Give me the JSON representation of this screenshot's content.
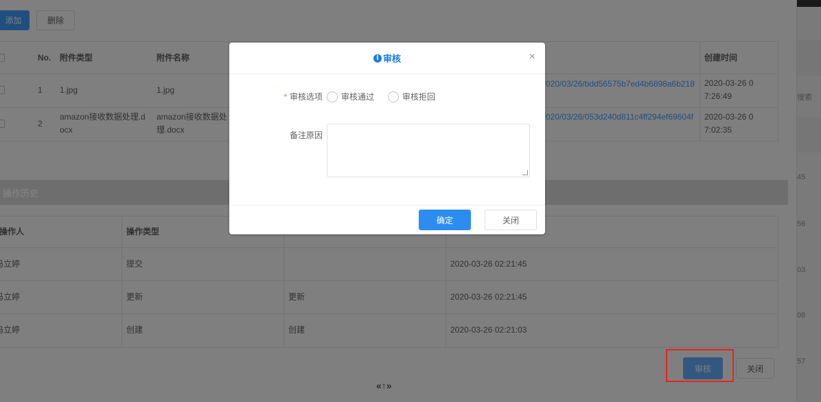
{
  "toolbar": {
    "add_label": "添加",
    "delete_label": "删除"
  },
  "attachments": {
    "headers": {
      "no": "No.",
      "type": "附件类型",
      "name": "附件名称",
      "created": "创建时间"
    },
    "rows": [
      {
        "no": "1",
        "type": "1.jpg",
        "name": "1.jpg",
        "path": "020/03/26/bdd56575b7ed4b6898a6b218",
        "created": "2020-03-26 07:26:49"
      },
      {
        "no": "2",
        "type": "amazon接收数据处理.docx",
        "name": "amazon接收数据处理.docx",
        "path": "020/03/26/053d240d811c4ff294ef69604f",
        "created": "2020-03-26 07:02:35"
      }
    ]
  },
  "history": {
    "section_title": "操作历史",
    "headers": {
      "operator": "操作人",
      "op_type": "操作类型"
    },
    "rows": [
      {
        "operator": "冯立婷",
        "op_type": "提交",
        "content": "",
        "time": "2020-03-26 02:21:45"
      },
      {
        "operator": "冯立婷",
        "op_type": "更新",
        "content": "更新",
        "time": "2020-03-26 02:21:45"
      },
      {
        "operator": "冯立婷",
        "op_type": "创建",
        "content": "创建",
        "time": "2020-03-26 02:21:03"
      }
    ]
  },
  "page_footer": {
    "review_label": "审核",
    "close_label": "关闭",
    "scroll_glyph": "«↑»"
  },
  "right_strip": {
    "search_text": "搜索",
    "numbers": [
      "45",
      "56",
      "03",
      "08",
      "57"
    ]
  },
  "dialog": {
    "title": "审核",
    "close_glyph": "×",
    "option_label": "审核选项",
    "required_mark": "*",
    "options": [
      "审核通过",
      "审核拒回"
    ],
    "remark_label": "备注原因",
    "remark_value": "",
    "confirm_label": "确定",
    "close_label": "关闭"
  },
  "colors": {
    "primary": "#409eff",
    "title_blue": "#1a7bea",
    "highlight_red": "#e52521"
  }
}
